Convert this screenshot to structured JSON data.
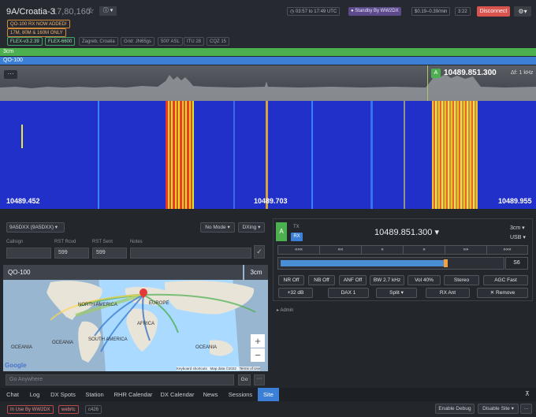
{
  "header": {
    "callsign": "9A/Croatia-3",
    "frequency": "17,80,160",
    "star_icon": "star-outline-icon",
    "info_icon": "info-icon",
    "time_range": "03:57 to 17:49 UTC",
    "standby": "Standby By WW2DX",
    "rate": "$0.19–0.39/min",
    "time": "3:22",
    "disconnect": "Disconnect",
    "settings_icon": "gear-icon"
  },
  "badges": {
    "notice1": "QO-100 RX NOW ADDED!",
    "notice2": "17M, 80M & 160M ONLY",
    "radio1": "FLEX-v3.2.39",
    "radio2": "FLEX-6600",
    "location": "Zagreb, Croatia",
    "grid": "Grid: JN65gs",
    "asl": "500' ASL",
    "itu": "ITU 28",
    "cqz": "CQZ 15"
  },
  "bands": {
    "band1": "3cm",
    "band2": "QO-100"
  },
  "panadapter": {
    "menu_label": "···",
    "slice_letter": "A",
    "slice_freq": "10489.851.300",
    "delta": "Δf: 1 kHz",
    "freq_left": "10489.452",
    "freq_mid": "10489.703",
    "freq_right": "10489.955"
  },
  "logging": {
    "station": "9A5DXX (9A5DXX)",
    "mode": "No Mode",
    "dxing": "DXing",
    "callsign_label": "Callsign",
    "rst_rcvd_label": "RST Rcvd",
    "rst_sent_label": "RST Sent",
    "notes_label": "Notes",
    "rst_rcvd_value": "599",
    "rst_sent_value": "599",
    "check_icon": "check-icon"
  },
  "map": {
    "title": "QO-100",
    "band": "3cm",
    "labels": {
      "north_america": "NORTH AMERICA",
      "europe": "EUROPE",
      "africa": "AFRICA",
      "south_america": "SOUTH AMERICA",
      "pacific1": "OCEANIA",
      "pacific2": "OCEANIA",
      "oceania": "OCEANIA"
    },
    "zoom_in": "+",
    "zoom_out": "−",
    "google": "Google",
    "attrib1": "Keyboard shortcuts",
    "attrib2": "Map data ©2022",
    "attrib3": "Terms of Use",
    "search_placeholder": "Go Anywhere",
    "go": "Go",
    "more": "···"
  },
  "slice": {
    "letter": "A",
    "tx": "TX",
    "rx": "RX",
    "freq": "10489.851.300 ▾",
    "band": "3cm ▾",
    "mode": "USB ▾",
    "nav": [
      "«««",
      "««",
      "«",
      "»",
      "»»",
      "»»»"
    ],
    "meter": "S6",
    "meter_level": 0.74,
    "buttons_row1": [
      "NR Off",
      "NB Off",
      "ANF Off",
      "BW 2.7 kHz",
      "Vol 40%",
      "Stereo",
      "AGC Fast"
    ],
    "buttons_row2": [
      "+32 dB",
      "DAX 1",
      "Split ▾",
      "RX Ant",
      "✕ Remove"
    ],
    "admin": "▸ Admin"
  },
  "tabs": [
    "Chat",
    "Log",
    "DX Spots",
    "Station",
    "RHR Calendar",
    "DX Calendar",
    "News",
    "Sessions",
    "Site"
  ],
  "active_tab": "Site",
  "pin_icon": "pin-icon",
  "status": {
    "in_use": "In Use By WW2DX",
    "webrtc": "webrtc",
    "code": "c426",
    "debug": "Enable Debug",
    "disable_site": "Disable Site ▾",
    "more": "···"
  },
  "colors": {
    "accent": "#4a8fd4",
    "disconnect": "#d9534f",
    "band_green": "#4caf50",
    "band_blue": "#3b7fd6",
    "waterfall_bg": "#2030c8"
  }
}
